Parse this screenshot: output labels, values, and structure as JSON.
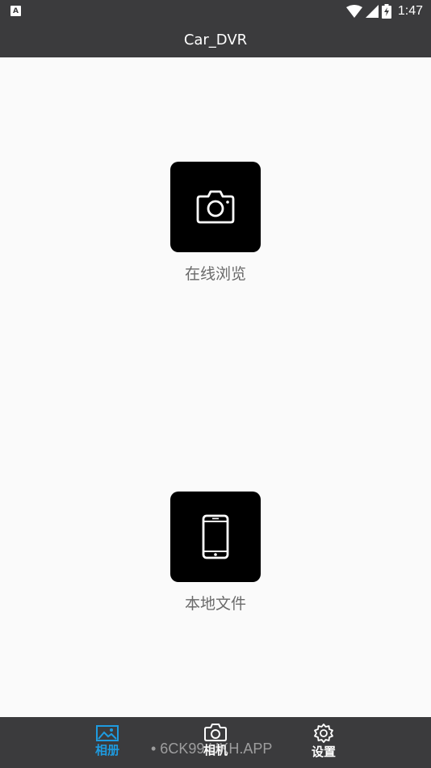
{
  "status_bar": {
    "time": "1:47",
    "left_icon_letter": "A",
    "icons": [
      "wifi-icon",
      "signal-icon",
      "battery-icon"
    ]
  },
  "app_bar": {
    "title": "Car_DVR"
  },
  "main": {
    "tiles": [
      {
        "label": "在线浏览",
        "icon": "camera-icon"
      },
      {
        "label": "本地文件",
        "icon": "phone-icon"
      }
    ]
  },
  "bottom_nav": {
    "items": [
      {
        "label": "相册",
        "icon": "gallery-icon",
        "active": true
      },
      {
        "label": "相机",
        "icon": "camera-icon",
        "active": false
      },
      {
        "label": "设置",
        "icon": "gear-icon",
        "active": false
      }
    ]
  },
  "watermark": "• 6CK99.UKH.APP",
  "colors": {
    "bar_background": "#3b3b3d",
    "active_tab": "#1e9be0",
    "tile_background": "#000000",
    "content_background": "#fafafa"
  }
}
